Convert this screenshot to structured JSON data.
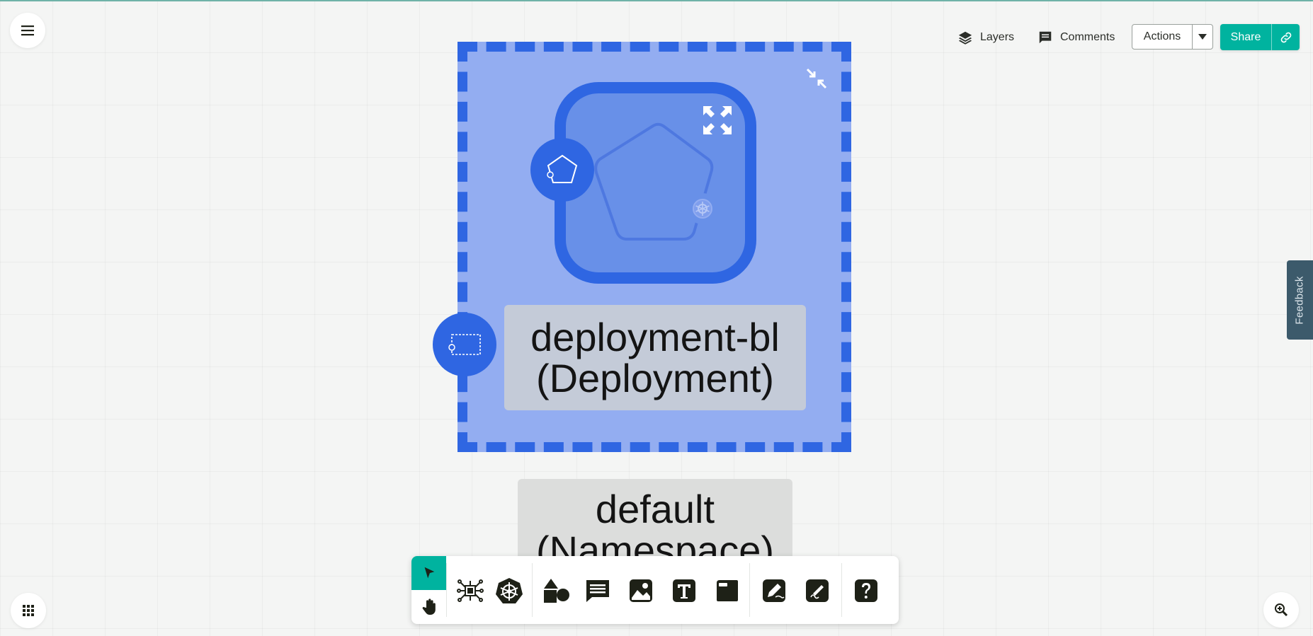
{
  "header": {
    "layers_label": "Layers",
    "comments_label": "Comments",
    "actions_label": "Actions",
    "share_label": "Share"
  },
  "feedback": {
    "label": "Feedback"
  },
  "canvas": {
    "deployment": {
      "line1": "deployment-bl",
      "line2": "(Deployment)"
    },
    "namespace": {
      "line1": "default",
      "line2": "(Namespace)"
    }
  },
  "colors": {
    "accent": "#00b39f",
    "node_blue": "#2f66e2",
    "node_fill": "#93adf1",
    "dark_ui": "#3c5a6b"
  },
  "icons": {
    "menu": "hamburger-icon",
    "apps": "grid-icon",
    "zoom": "zoom-icon",
    "layers": "layers-icon",
    "comments": "comment-icon",
    "link": "link-icon",
    "dock": [
      "pointer-icon",
      "hand-icon",
      "component-icon",
      "kubernetes-icon",
      "shapes-icon",
      "comment-icon",
      "image-icon",
      "text-icon",
      "section-icon",
      "pen-icon",
      "freehand-icon",
      "help-icon"
    ]
  }
}
